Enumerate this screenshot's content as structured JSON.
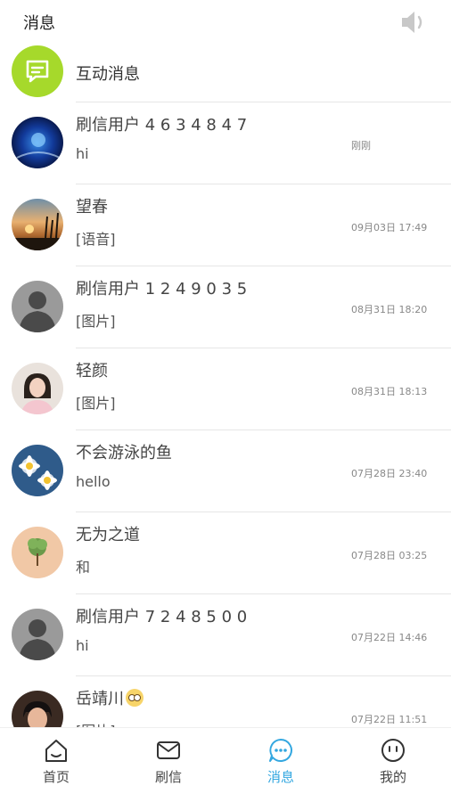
{
  "header": {
    "title": "消息"
  },
  "interaction": {
    "label": "互动消息"
  },
  "conversations": [
    {
      "name": "刷信用户 4 6 3 4 8 4 7",
      "preview": "hi",
      "time": "刚刚"
    },
    {
      "name": "望春",
      "preview": "[语音]",
      "time": "09月03日 17:49"
    },
    {
      "name": "刷信用户 1 2 4 9 0 3 5",
      "preview": "[图片]",
      "time": "08月31日 18:20"
    },
    {
      "name": "轻颜",
      "preview": "[图片]",
      "time": "08月31日 18:13"
    },
    {
      "name": "不会游泳的鱼",
      "preview": "hello",
      "time": "07月28日 23:40"
    },
    {
      "name": "无为之道",
      "preview": "和",
      "time": "07月28日 03:25"
    },
    {
      "name": "刷信用户 7 2 4 8 5 0 0",
      "preview": "hi",
      "time": "07月22日 14:46"
    },
    {
      "name": "岳靖川",
      "preview": "[图片]",
      "time": "07月22日 11:51"
    }
  ],
  "tabs": [
    {
      "label": "首页",
      "icon": "home-icon"
    },
    {
      "label": "刷信",
      "icon": "mail-icon"
    },
    {
      "label": "消息",
      "icon": "chat-icon",
      "active": true
    },
    {
      "label": "我的",
      "icon": "profile-face-icon"
    }
  ],
  "colors": {
    "accent": "#33a7e0",
    "interaction_icon_bg": "#a6d92b",
    "divider": "#e6e6e6"
  }
}
